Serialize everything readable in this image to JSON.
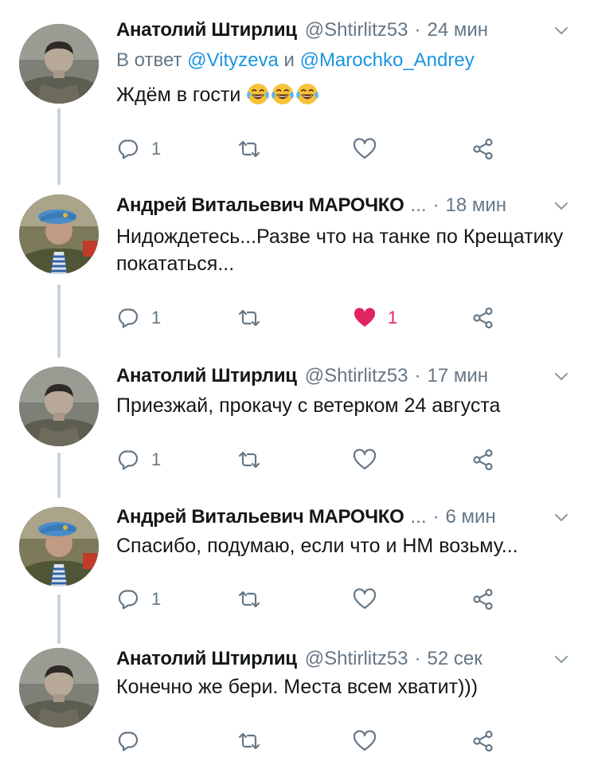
{
  "colors": {
    "text": "#14171a",
    "muted": "#657786",
    "link": "#1b95e0",
    "like": "#e0245e",
    "thread": "#c8d3dc"
  },
  "tweets": [
    {
      "author": "Анатолий Штирлиц",
      "handle": "@Shtirlitz53",
      "dots": "",
      "time": "24 мин",
      "reply_prefix": "В ответ ",
      "reply_a": "@Vityzeva",
      "reply_mid": " и ",
      "reply_b": "@Marochko_Andrey",
      "text": "Ждём в гости",
      "emoji": "face-with-tears-of-joy x3",
      "replies": "1",
      "retweets": "",
      "likes": "",
      "liked": false
    },
    {
      "author": "Андрей Витальевич МАРОЧКО",
      "handle": "",
      "dots": "...",
      "time": "18 мин",
      "text": "Нидождетесь...Разве что на танке по Крещатику покататься...",
      "replies": "1",
      "retweets": "",
      "likes": "1",
      "liked": true
    },
    {
      "author": "Анатолий Штирлиц",
      "handle": "@Shtirlitz53",
      "dots": "",
      "time": "17 мин",
      "text": "Приезжай, прокачу с ветерком 24 августа",
      "replies": "1",
      "retweets": "",
      "likes": "",
      "liked": false
    },
    {
      "author": "Андрей Витальевич МАРОЧКО",
      "handle": "",
      "dots": "...",
      "time": "6 мин",
      "text": "Спасибо, подумаю, если что и НМ возьму...",
      "replies": "1",
      "retweets": "",
      "likes": "",
      "liked": false
    },
    {
      "author": "Анатолий Штирлиц",
      "handle": "@Shtirlitz53",
      "dots": "",
      "time": "52 сек",
      "text": "Конечно же бери. Места всем хватит)))",
      "replies": "",
      "retweets": "",
      "likes": "",
      "liked": false
    }
  ]
}
